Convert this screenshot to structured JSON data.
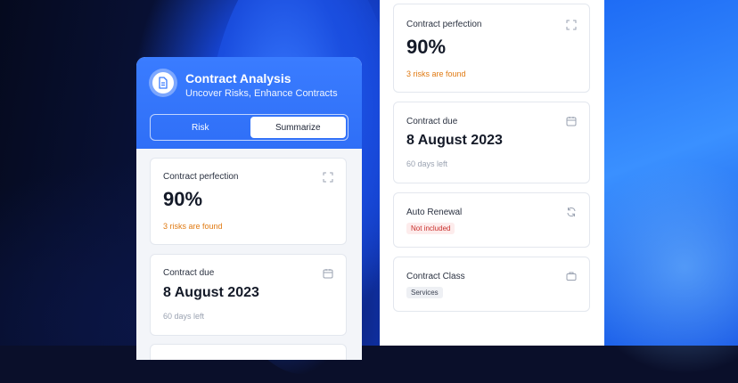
{
  "app": {
    "title": "Contract Analysis",
    "subtitle": "Uncover Risks, Enhance Contracts",
    "tabs": [
      {
        "label": "Risk",
        "active": false
      },
      {
        "label": "Summarize",
        "active": true
      }
    ]
  },
  "left_cards": {
    "perfection": {
      "label": "Contract perfection",
      "value": "90%",
      "note": "3 risks are found",
      "icon": "expand-icon"
    },
    "due": {
      "label": "Contract due",
      "value": "8 August 2023",
      "note": "60 days left",
      "icon": "calendar-icon"
    }
  },
  "right_cards": {
    "perfection": {
      "label": "Contract perfection",
      "value": "90%",
      "note": "3 risks are found",
      "icon": "expand-icon"
    },
    "due": {
      "label": "Contract due",
      "value": "8 August 2023",
      "note": "60 days left",
      "icon": "calendar-icon"
    },
    "renewal": {
      "label": "Auto Renewal",
      "tag": "Not included",
      "icon": "refresh-icon"
    },
    "class": {
      "label": "Contract Class",
      "tag": "Services",
      "icon": "briefcase-icon"
    }
  },
  "colors": {
    "accent": "#3a7cff",
    "warning": "#e07a12",
    "danger": "#c9302c"
  }
}
